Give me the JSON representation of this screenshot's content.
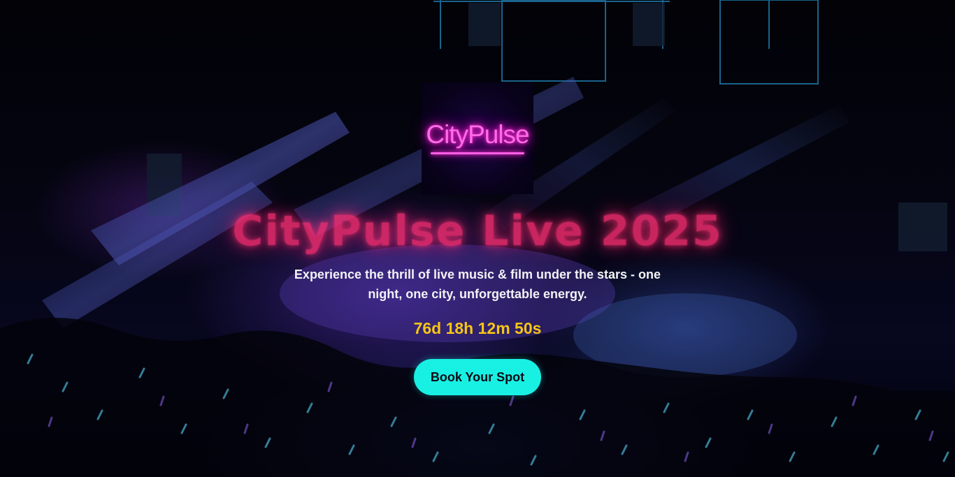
{
  "logo": {
    "text": "CityPulse"
  },
  "hero": {
    "title": "CityPulse Live 2025",
    "subtitle": "Experience the thrill of live music & film under the stars - one night, one city, unforgettable energy.",
    "countdown": "76d 18h 12m 50s",
    "cta_label": "Book Your Spot"
  },
  "colors": {
    "title": "#ff2e73",
    "countdown": "#f5c518",
    "cta_bg": "#19f0e4",
    "logo_neon": "#ff6be8"
  }
}
